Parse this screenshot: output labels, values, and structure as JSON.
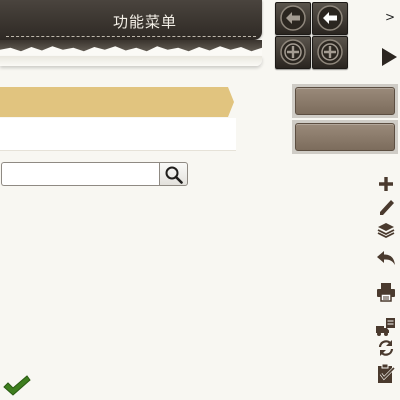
{
  "menu": {
    "title": "功能菜单"
  },
  "nav_buttons": [
    {
      "icon": "arrow-left-icon"
    },
    {
      "icon": "arrow-left-icon"
    },
    {
      "icon": "plus-circle-icon"
    },
    {
      "icon": "plus-circle-icon"
    }
  ],
  "more_label": ">",
  "search": {
    "placeholder": "",
    "value": ""
  },
  "tools": [
    {
      "icon": "plus-icon"
    },
    {
      "icon": "pencil-icon"
    },
    {
      "icon": "layers-icon"
    },
    {
      "icon": "undo-icon"
    },
    {
      "icon": "printer-icon"
    },
    {
      "icon": "truck-document-icon"
    },
    {
      "icon": "refresh-icon"
    },
    {
      "icon": "clipboard-check-icon"
    }
  ],
  "colors": {
    "header": "#2e2924",
    "ribbon": "#e1c47f",
    "side_button": "#8a7a6a",
    "icon": "#4a3a2e",
    "check": "#3e7e1e"
  }
}
